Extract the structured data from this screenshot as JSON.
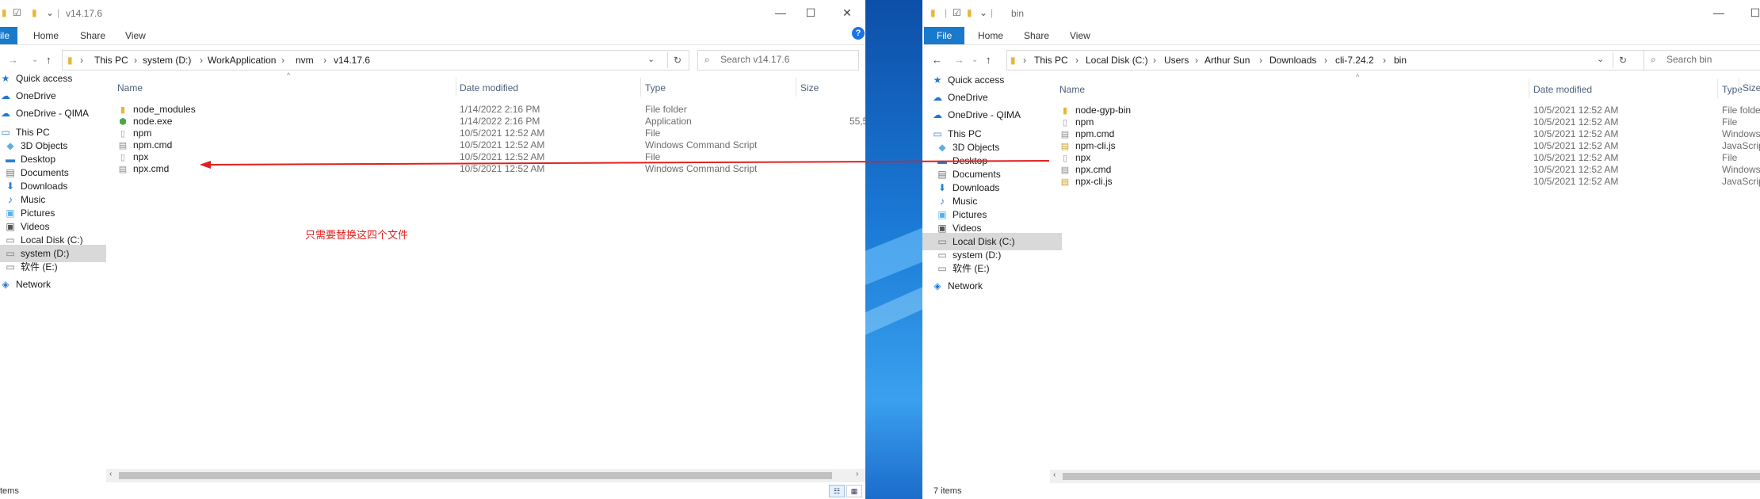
{
  "left_window": {
    "title": "v14.17.6",
    "ribbon_tabs": [
      "ile",
      "Home",
      "Share",
      "View"
    ],
    "breadcrumb": [
      "This PC",
      "system (D:)",
      "WorkApplication",
      "nvm",
      "v14.17.6"
    ],
    "search_placeholder": "Search v14.17.6",
    "columns": [
      "Name",
      "Date modified",
      "Type",
      "Size"
    ],
    "files": [
      {
        "name": "node_modules",
        "date": "1/14/2022 2:16 PM",
        "type": "File folder",
        "size": "",
        "icon": "folder-icon"
      },
      {
        "name": "node.exe",
        "date": "1/14/2022 2:16 PM",
        "type": "Application",
        "size": "55,5",
        "icon": "exe-icon"
      },
      {
        "name": "npm",
        "date": "10/5/2021 12:52 AM",
        "type": "File",
        "size": "",
        "icon": "file-icon"
      },
      {
        "name": "npm.cmd",
        "date": "10/5/2021 12:52 AM",
        "type": "Windows Command Script",
        "size": "",
        "icon": "cmd-icon"
      },
      {
        "name": "npx",
        "date": "10/5/2021 12:52 AM",
        "type": "File",
        "size": "",
        "icon": "file-icon"
      },
      {
        "name": "npx.cmd",
        "date": "10/5/2021 12:52 AM",
        "type": "Windows Command Script",
        "size": "",
        "icon": "cmd-icon"
      }
    ],
    "nav": [
      {
        "label": "Quick access",
        "icon": "star-icon"
      },
      {
        "label": "OneDrive",
        "icon": "cloud-icon"
      },
      {
        "label": "OneDrive - QIMA",
        "icon": "cloud-icon"
      },
      {
        "label": "This PC",
        "icon": "computer-icon"
      },
      {
        "label": "3D Objects",
        "icon": "cube-icon"
      },
      {
        "label": "Desktop",
        "icon": "desktop-icon"
      },
      {
        "label": "Documents",
        "icon": "documents-icon"
      },
      {
        "label": "Downloads",
        "icon": "download-icon"
      },
      {
        "label": "Music",
        "icon": "music-icon"
      },
      {
        "label": "Pictures",
        "icon": "pictures-icon"
      },
      {
        "label": "Videos",
        "icon": "videos-icon"
      },
      {
        "label": "Local Disk (C:)",
        "icon": "drive-icon"
      },
      {
        "label": "system (D:)",
        "icon": "drive-icon"
      },
      {
        "label": "软件 (E:)",
        "icon": "drive-icon"
      },
      {
        "label": "Network",
        "icon": "network-icon"
      }
    ],
    "selected_nav": "system (D:)",
    "status": "tems",
    "annotation": "只需要替换这四个文件"
  },
  "right_window": {
    "title": "bin",
    "ribbon_tabs": [
      "File",
      "Home",
      "Share",
      "View"
    ],
    "breadcrumb": [
      "This PC",
      "Local Disk (C:)",
      "Users",
      "Arthur Sun",
      "Downloads",
      "cli-7.24.2",
      "bin"
    ],
    "search_placeholder": "Search bin",
    "columns": [
      "Name",
      "Date modified",
      "Type",
      "Size"
    ],
    "files": [
      {
        "name": "node-gyp-bin",
        "date": "10/5/2021 12:52 AM",
        "type": "File folder",
        "icon": "folder-icon"
      },
      {
        "name": "npm",
        "date": "10/5/2021 12:52 AM",
        "type": "File",
        "icon": "file-icon"
      },
      {
        "name": "npm.cmd",
        "date": "10/5/2021 12:52 AM",
        "type": "Windows Command Script",
        "icon": "cmd-icon"
      },
      {
        "name": "npm-cli.js",
        "date": "10/5/2021 12:52 AM",
        "type": "JavaScript Source File",
        "icon": "js-icon"
      },
      {
        "name": "npx",
        "date": "10/5/2021 12:52 AM",
        "type": "File",
        "icon": "file-icon"
      },
      {
        "name": "npx.cmd",
        "date": "10/5/2021 12:52 AM",
        "type": "Windows Command Script",
        "icon": "cmd-icon"
      },
      {
        "name": "npx-cli.js",
        "date": "10/5/2021 12:52 AM",
        "type": "JavaScript Source File",
        "icon": "js-icon"
      }
    ],
    "nav": [
      {
        "label": "Quick access",
        "icon": "star-icon"
      },
      {
        "label": "OneDrive",
        "icon": "cloud-icon"
      },
      {
        "label": "OneDrive - QIMA",
        "icon": "cloud-icon"
      },
      {
        "label": "This PC",
        "icon": "computer-icon"
      },
      {
        "label": "3D Objects",
        "icon": "cube-icon"
      },
      {
        "label": "Desktop",
        "icon": "desktop-icon"
      },
      {
        "label": "Documents",
        "icon": "documents-icon"
      },
      {
        "label": "Downloads",
        "icon": "download-icon"
      },
      {
        "label": "Music",
        "icon": "music-icon"
      },
      {
        "label": "Pictures",
        "icon": "pictures-icon"
      },
      {
        "label": "Videos",
        "icon": "videos-icon"
      },
      {
        "label": "Local Disk (C:)",
        "icon": "drive-icon"
      },
      {
        "label": "system (D:)",
        "icon": "drive-icon"
      },
      {
        "label": "软件 (E:)",
        "icon": "drive-icon"
      },
      {
        "label": "Network",
        "icon": "network-icon"
      }
    ],
    "selected_nav": "Local Disk (C:)",
    "status": "7 items"
  },
  "colors": {
    "accent": "#1979ca",
    "annotation": "#e02020",
    "desktop": "#1a7ad6"
  }
}
